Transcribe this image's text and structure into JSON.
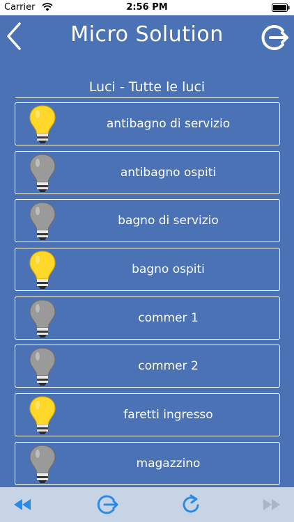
{
  "status_bar": {
    "carrier": "Carrier",
    "time": "2:56 PM"
  },
  "header": {
    "title": "Micro Solution"
  },
  "section": {
    "title": "Luci - Tutte le luci"
  },
  "lights": [
    {
      "name": "antibagno di servizio",
      "on": true
    },
    {
      "name": "antibagno ospiti",
      "on": false
    },
    {
      "name": "bagno di servizio",
      "on": false
    },
    {
      "name": "bagno ospiti",
      "on": true
    },
    {
      "name": "commer 1",
      "on": false
    },
    {
      "name": "commer 2",
      "on": false
    },
    {
      "name": "faretti ingresso",
      "on": true
    },
    {
      "name": "magazzino",
      "on": false
    }
  ],
  "colors": {
    "background": "#4a72b4",
    "bulb_on": "#ffd82a",
    "bulb_off": "#9a9a9a",
    "toolbar": "#c7d4e6",
    "toolbar_icon": "#2a8be6",
    "toolbar_icon_disabled": "#a9b6c7"
  },
  "icons": {
    "back": "chevron-left-icon",
    "logout": "logout-icon",
    "rewind": "rewind-icon",
    "refresh": "refresh-icon",
    "fast_forward": "fast-forward-icon"
  }
}
